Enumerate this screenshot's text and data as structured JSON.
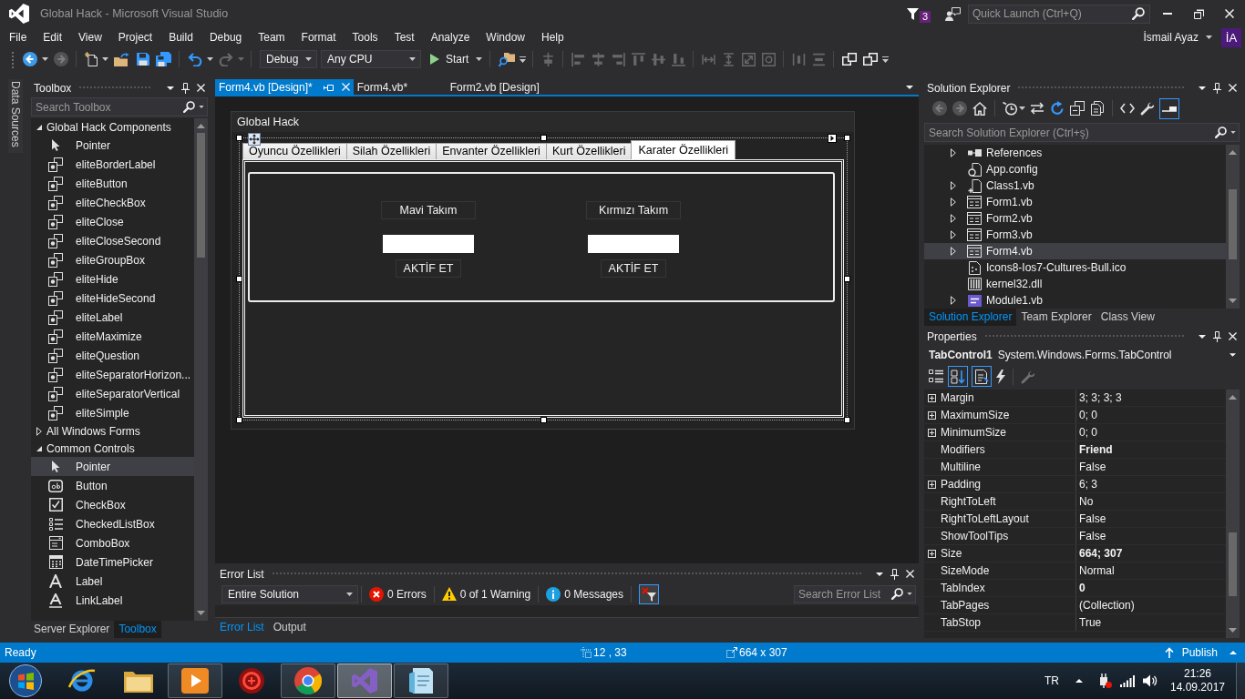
{
  "window": {
    "title": "Global Hack - Microsoft Visual Studio",
    "notification_count": "3",
    "quick_launch": {
      "placeholder": "Quick Launch (Ctrl+Q)"
    }
  },
  "menu": [
    "File",
    "Edit",
    "View",
    "Project",
    "Build",
    "Debug",
    "Team",
    "Format",
    "Tools",
    "Test",
    "Analyze",
    "Window",
    "Help"
  ],
  "account": {
    "name": "İsmail Ayaz",
    "initials": "İA"
  },
  "toolbar": [
    [
      {
        "kind": "back",
        "disabled": false
      },
      {
        "kind": "caret",
        "disabled": false
      },
      {
        "kind": "forward",
        "disabled": true
      }
    ],
    [
      {
        "kind": "new-project",
        "disabled": false
      },
      {
        "kind": "caret",
        "disabled": false
      },
      {
        "kind": "open",
        "disabled": false
      },
      {
        "kind": "save",
        "disabled": false
      },
      {
        "kind": "save-all",
        "disabled": false
      }
    ],
    [
      {
        "kind": "undo",
        "disabled": false
      },
      {
        "kind": "caret",
        "disabled": false
      },
      {
        "kind": "redo",
        "disabled": true
      },
      {
        "kind": "caret",
        "disabled": true
      }
    ],
    [
      {
        "kind": "combo",
        "value": "Debug"
      },
      {
        "kind": "combo",
        "value": "Any CPU"
      },
      {
        "kind": "run",
        "label": "Start"
      }
    ],
    [
      {
        "kind": "find",
        "disabled": false
      },
      {
        "kind": "overflow",
        "disabled": false
      }
    ],
    [
      {
        "kind": "align-grid",
        "disabled": true
      }
    ],
    [
      {
        "kind": "align-left",
        "disabled": true
      },
      {
        "kind": "align-center",
        "disabled": true
      },
      {
        "kind": "align-right",
        "disabled": true
      },
      {
        "kind": "align-top",
        "disabled": true
      },
      {
        "kind": "align-middle",
        "disabled": true
      },
      {
        "kind": "align-bottom",
        "disabled": true
      }
    ],
    [
      {
        "kind": "same-width",
        "disabled": true
      },
      {
        "kind": "same-height",
        "disabled": true
      },
      {
        "kind": "same-size",
        "disabled": true
      },
      {
        "kind": "size-grid",
        "disabled": true
      }
    ],
    [
      {
        "kind": "h-spacing",
        "disabled": true
      },
      {
        "kind": "v-spacing",
        "disabled": true
      }
    ],
    [
      {
        "kind": "bring-front",
        "disabled": false
      },
      {
        "kind": "send-back",
        "disabled": false
      },
      {
        "kind": "overflow",
        "disabled": false
      }
    ]
  ],
  "side_tabs": [
    "Data Sources"
  ],
  "toolbox": {
    "title": "Toolbox",
    "search": {
      "placeholder": "Search Toolbox"
    },
    "groups": [
      {
        "label": "Global Hack Components",
        "expanded": true,
        "items": [
          {
            "label": "Pointer",
            "kind": "pointer",
            "selected": false
          },
          {
            "label": "eliteBorderLabel",
            "kind": "component",
            "selected": false
          },
          {
            "label": "eliteButton",
            "kind": "component",
            "selected": false
          },
          {
            "label": "eliteCheckBox",
            "kind": "component",
            "selected": false
          },
          {
            "label": "eliteClose",
            "kind": "component",
            "selected": false
          },
          {
            "label": "eliteCloseSecond",
            "kind": "component",
            "selected": false
          },
          {
            "label": "eliteGroupBox",
            "kind": "component",
            "selected": false
          },
          {
            "label": "eliteHide",
            "kind": "component",
            "selected": false
          },
          {
            "label": "eliteHideSecond",
            "kind": "component",
            "selected": false
          },
          {
            "label": "eliteLabel",
            "kind": "component",
            "selected": false
          },
          {
            "label": "eliteMaximize",
            "kind": "component",
            "selected": false
          },
          {
            "label": "eliteQuestion",
            "kind": "component",
            "selected": false
          },
          {
            "label": "eliteSeparatorHorizon...",
            "kind": "component",
            "selected": false
          },
          {
            "label": "eliteSeparatorVertical",
            "kind": "component",
            "selected": false
          },
          {
            "label": "eliteSimple",
            "kind": "component",
            "selected": false
          }
        ]
      },
      {
        "label": "All Windows Forms",
        "expanded": false
      },
      {
        "label": "Common Controls",
        "expanded": true,
        "items": [
          {
            "label": "Pointer",
            "kind": "pointer",
            "selected": true
          },
          {
            "label": "Button",
            "kind": "button",
            "selected": false
          },
          {
            "label": "CheckBox",
            "kind": "checkbox",
            "selected": false
          },
          {
            "label": "CheckedListBox",
            "kind": "checked-list",
            "selected": false
          },
          {
            "label": "ComboBox",
            "kind": "combo",
            "selected": false
          },
          {
            "label": "DateTimePicker",
            "kind": "date-picker",
            "selected": false
          },
          {
            "label": "Label",
            "kind": "label",
            "selected": false
          },
          {
            "label": "LinkLabel",
            "kind": "link-label",
            "selected": false
          }
        ]
      }
    ],
    "tabs": [
      {
        "label": "Server Explorer",
        "selected": false
      },
      {
        "label": "Toolbox",
        "selected": true
      }
    ]
  },
  "documents": {
    "tabs": [
      {
        "label": "Form4.vb [Design]*",
        "selected": true
      },
      {
        "label": "Form4.vb*",
        "selected": false
      },
      {
        "label": "Form2.vb [Design]",
        "selected": false
      }
    ],
    "form": {
      "title": "Global Hack",
      "tabs": [
        {
          "label": "Oyuncu Özellikleri",
          "selected": false
        },
        {
          "label": "Silah Özellikleri",
          "selected": false
        },
        {
          "label": "Envanter Özellikleri",
          "selected": false
        },
        {
          "label": "Kurt Özellikleri",
          "selected": false
        },
        {
          "label": "Karater Özellikleri",
          "selected": true
        }
      ],
      "teams": [
        {
          "label": "Mavi Takım",
          "button": "AKTİF ET"
        },
        {
          "label": "Kırmızı Takım",
          "button": "AKTİF ET"
        }
      ]
    }
  },
  "error_list": {
    "title": "Error List",
    "scope": "Entire Solution",
    "counts": [
      {
        "kind": "error",
        "label": "0 Errors"
      },
      {
        "kind": "warning",
        "label": "0 of 1 Warning"
      },
      {
        "kind": "info",
        "label": "0 Messages"
      }
    ],
    "build_filter": {
      "selected": true
    },
    "search": {
      "placeholder": "Search Error List"
    },
    "tabs": [
      {
        "label": "Error List",
        "selected": true
      },
      {
        "label": "Output",
        "selected": false
      }
    ]
  },
  "solution_explorer": {
    "title": "Solution Explorer",
    "toolbar": [
      [
        {
          "kind": "back",
          "disabled": true
        },
        {
          "kind": "forward",
          "disabled": true
        },
        {
          "kind": "home",
          "disabled": false
        }
      ],
      [
        {
          "kind": "history",
          "disabled": false
        },
        {
          "kind": "caret",
          "disabled": false
        },
        {
          "kind": "sync",
          "disabled": false
        },
        {
          "kind": "refresh",
          "disabled": false
        },
        {
          "kind": "collapse",
          "disabled": false
        },
        {
          "kind": "show-all",
          "disabled": false
        }
      ],
      [
        {
          "kind": "code",
          "disabled": false
        },
        {
          "kind": "wrench",
          "disabled": false
        },
        {
          "kind": "preview",
          "selected": true
        }
      ]
    ],
    "search": {
      "placeholder": "Search Solution Explorer (Ctrl+ş)"
    },
    "items": [
      {
        "label": "References",
        "kind": "references",
        "expanded": false,
        "selected": false
      },
      {
        "label": "App.config",
        "kind": "config",
        "selected": false
      },
      {
        "label": "Class1.vb",
        "kind": "class",
        "expanded": false,
        "selected": false
      },
      {
        "label": "Form1.vb",
        "kind": "form",
        "expanded": false,
        "selected": false
      },
      {
        "label": "Form2.vb",
        "kind": "form",
        "expanded": false,
        "selected": false
      },
      {
        "label": "Form3.vb",
        "kind": "form",
        "expanded": false,
        "selected": false
      },
      {
        "label": "Form4.vb",
        "kind": "form",
        "expanded": false,
        "selected": true
      },
      {
        "label": "Icons8-Ios7-Cultures-Bull.ico",
        "kind": "image",
        "selected": false
      },
      {
        "label": "kernel32.dll",
        "kind": "library",
        "selected": false
      },
      {
        "label": "Module1.vb",
        "kind": "module",
        "expanded": false,
        "selected": false
      }
    ],
    "tabs": [
      {
        "label": "Solution Explorer",
        "selected": true
      },
      {
        "label": "Team Explorer",
        "selected": false
      },
      {
        "label": "Class View",
        "selected": false
      }
    ]
  },
  "properties": {
    "title": "Properties",
    "object": {
      "name": "TabControl1",
      "type": "System.Windows.Forms.TabControl"
    },
    "toolbar": [
      [
        {
          "kind": "categorized",
          "selected": false
        },
        {
          "kind": "alphabetical",
          "selected": true
        },
        {
          "kind": "properties",
          "selected": true
        },
        {
          "kind": "events",
          "selected": false
        }
      ],
      [
        {
          "kind": "wrench",
          "disabled": true
        }
      ]
    ],
    "rows": [
      {
        "name": "Margin",
        "value": "3; 3; 3; 3",
        "expanded": false,
        "modified": false
      },
      {
        "name": "MaximumSize",
        "value": "0; 0",
        "expanded": false,
        "modified": false
      },
      {
        "name": "MinimumSize",
        "value": "0; 0",
        "expanded": false,
        "modified": false
      },
      {
        "name": "Modifiers",
        "value": "Friend",
        "modified": true
      },
      {
        "name": "Multiline",
        "value": "False",
        "modified": false
      },
      {
        "name": "Padding",
        "value": "6; 3",
        "expanded": false,
        "modified": false
      },
      {
        "name": "RightToLeft",
        "value": "No",
        "modified": false
      },
      {
        "name": "RightToLeftLayout",
        "value": "False",
        "modified": false
      },
      {
        "name": "ShowToolTips",
        "value": "False",
        "modified": false
      },
      {
        "name": "Size",
        "value": "664; 307",
        "expanded": false,
        "modified": true
      },
      {
        "name": "SizeMode",
        "value": "Normal",
        "modified": false
      },
      {
        "name": "TabIndex",
        "value": "0",
        "modified": true
      },
      {
        "name": "TabPages",
        "value": "(Collection)",
        "modified": false
      },
      {
        "name": "TabStop",
        "value": "True",
        "modified": false
      }
    ]
  },
  "status_bar": {
    "text": "Ready",
    "position": "12 , 33",
    "size": "664 x 307",
    "publish": "Publish"
  },
  "taskbar": {
    "apps": [
      {
        "kind": "browser",
        "running": false,
        "selected": false
      },
      {
        "kind": "folder",
        "running": false,
        "selected": false
      },
      {
        "kind": "media",
        "running": true,
        "selected": false
      },
      {
        "kind": "emblem",
        "running": false,
        "selected": false
      },
      {
        "kind": "circle",
        "running": true,
        "selected": false
      },
      {
        "kind": "studio",
        "running": true,
        "selected": true
      },
      {
        "kind": "notes",
        "running": true,
        "selected": false
      }
    ],
    "language": "TR",
    "time": "21:26",
    "date": "14.09.2017"
  }
}
